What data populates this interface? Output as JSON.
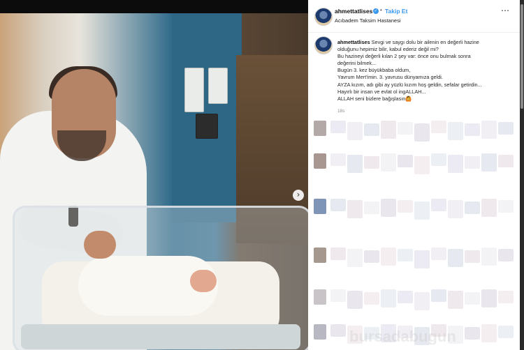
{
  "post": {
    "image_alt": "",
    "carousel": {
      "dot_count": 9,
      "active_index": 0
    }
  },
  "header": {
    "username": "ahmettatlises",
    "follow_label": "Takip Et",
    "separator": "•",
    "location": "Acıbadem Taksim Hastanesi"
  },
  "caption": {
    "username": "ahmettatlises",
    "lines": [
      "Sevgi ve saygı dolu bir ailenin en değerli hazine",
      "olduğunu hepimiz bilir, kabul ederiz değil mi?",
      "Bu hazineyi değerli kılan 2 şey var: önce onu bulmak sonra",
      "değerini bilmek...",
      "Bugün 3. kez büyükbaba oldum,",
      "Yavrum Mert'imin. 3. yavrusu dünyamıza geldi.",
      "AYZA kızım, adı gibi ay yüzlü kızım hoş geldin, sefalar getirdin...",
      "Hayırlı bir insan ve evlat ol ingALLAH...",
      "ALLAH seni bizlere bağışlasın🙆"
    ],
    "time": "18s"
  },
  "icons": {
    "verified": "verified-badge-icon",
    "more": "more-options-icon",
    "next": "carousel-next-icon"
  },
  "colors": {
    "accent": "#3897f0",
    "text": "#262626",
    "muted": "#8e8e8e"
  },
  "watermark": "bursadabugun"
}
